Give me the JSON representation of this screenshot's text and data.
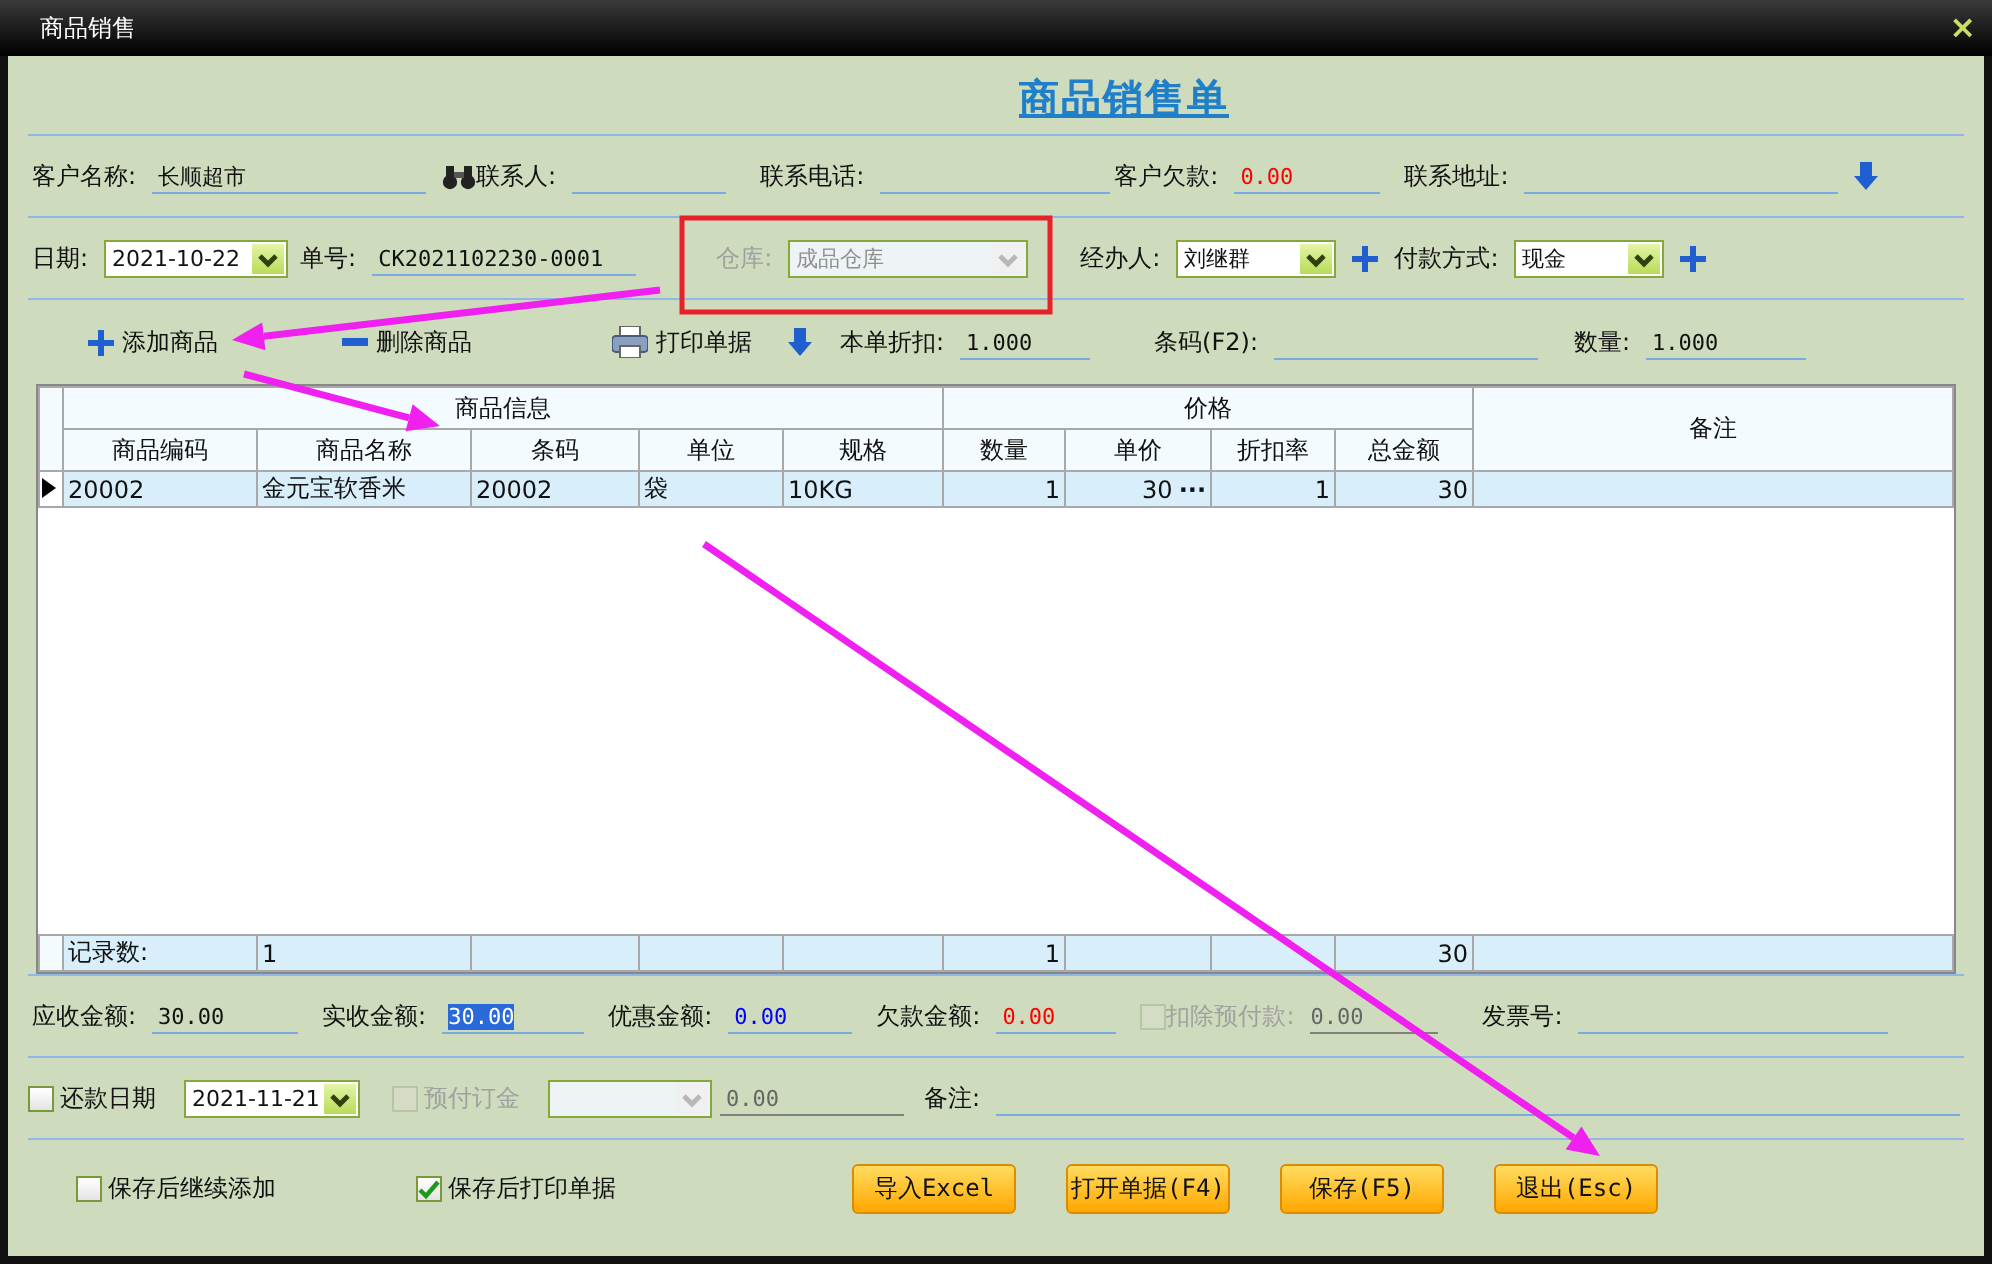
{
  "window": {
    "title": "商品销售",
    "close": "×"
  },
  "heading": "商品销售单",
  "customer_row": [
    {
      "label": "客户名称:",
      "kind": "text",
      "value": "长顺超市"
    },
    {
      "label": "联系人:",
      "kind": "text"
    },
    {
      "label": "联系电话:",
      "kind": "text"
    },
    {
      "label": "客户欠款:",
      "kind": "text",
      "value": "0.00",
      "color": "#ff0000"
    },
    {
      "label": "联系地址:",
      "kind": "text"
    }
  ],
  "order_row": [
    {
      "label": "日期:",
      "kind": "select",
      "value": "2021-10-22",
      "disabled": false
    },
    {
      "label": "单号:",
      "kind": "text",
      "value": "CK2021102230-0001"
    },
    {
      "label": "仓库:",
      "kind": "select",
      "value": "成品仓库",
      "disabled": true
    },
    {
      "label": "经办人:",
      "kind": "select",
      "value": "刘继群",
      "disabled": false
    },
    {
      "label": "付款方式:",
      "kind": "select",
      "value": "现金",
      "disabled": false
    }
  ],
  "toolbar": {
    "actions": [
      {
        "label": "添加商品"
      },
      {
        "label": "删除商品"
      },
      {
        "label": "打印单据"
      }
    ],
    "fields": [
      {
        "label": "本单折扣:",
        "value": "1.000"
      },
      {
        "label": "条码(F2):"
      },
      {
        "label": "数量:",
        "value": "1.000"
      }
    ]
  },
  "table": {
    "groups": [
      {
        "label": "商品信息"
      },
      {
        "label": "价格"
      }
    ],
    "remark_column": "备注",
    "columns": [
      "商品编码",
      "商品名称",
      "条码",
      "单位",
      "规格",
      "数量",
      "单价",
      "折扣率",
      "总金额"
    ],
    "rows": [
      {
        "selected": true,
        "cells": [
          "20002",
          "金元宝软香米",
          "20002",
          "袋",
          "10KG",
          "1",
          "30",
          "1",
          "30"
        ],
        "more": "···"
      }
    ],
    "footer": {
      "label": "记录数:",
      "record_count": "1",
      "quantity_sum": "1",
      "amount_sum": "30"
    }
  },
  "totals": [
    {
      "label": "应收金额:",
      "kind": "text",
      "value": "30.00"
    },
    {
      "label": "实收金额:",
      "kind": "text",
      "value": "30.00",
      "highlighted": true
    },
    {
      "label": "优惠金额:",
      "kind": "text",
      "value": "0.00",
      "color": "#0000ff"
    },
    {
      "label": "欠款金额:",
      "kind": "text",
      "value": "0.00",
      "color": "#ff0000"
    },
    {
      "label": "扣除预付款:",
      "kind": "check",
      "checked": false,
      "disabled": true,
      "value": "0.00"
    },
    {
      "label": "发票号:",
      "kind": "text"
    }
  ],
  "payment_row": [
    {
      "label": "还款日期",
      "kind": "check",
      "checked": false,
      "disabled": false,
      "date": "2021-11-21"
    },
    {
      "label": "预付订金",
      "kind": "check",
      "checked": false,
      "disabled": true,
      "value": "0.00"
    },
    {
      "label": "备注:",
      "kind": "text"
    }
  ],
  "options": [
    {
      "label": "保存后继续添加",
      "checked": false
    },
    {
      "label": "保存后打印单据",
      "checked": true
    }
  ],
  "buttons": [
    "导入Excel",
    "打开单据(F4)",
    "保存(F5)",
    "退出(Esc)"
  ],
  "markup": [
    {
      "kind": "box"
    },
    {
      "kind": "arrow"
    },
    {
      "kind": "arrow"
    },
    {
      "kind": "arrow"
    }
  ]
}
